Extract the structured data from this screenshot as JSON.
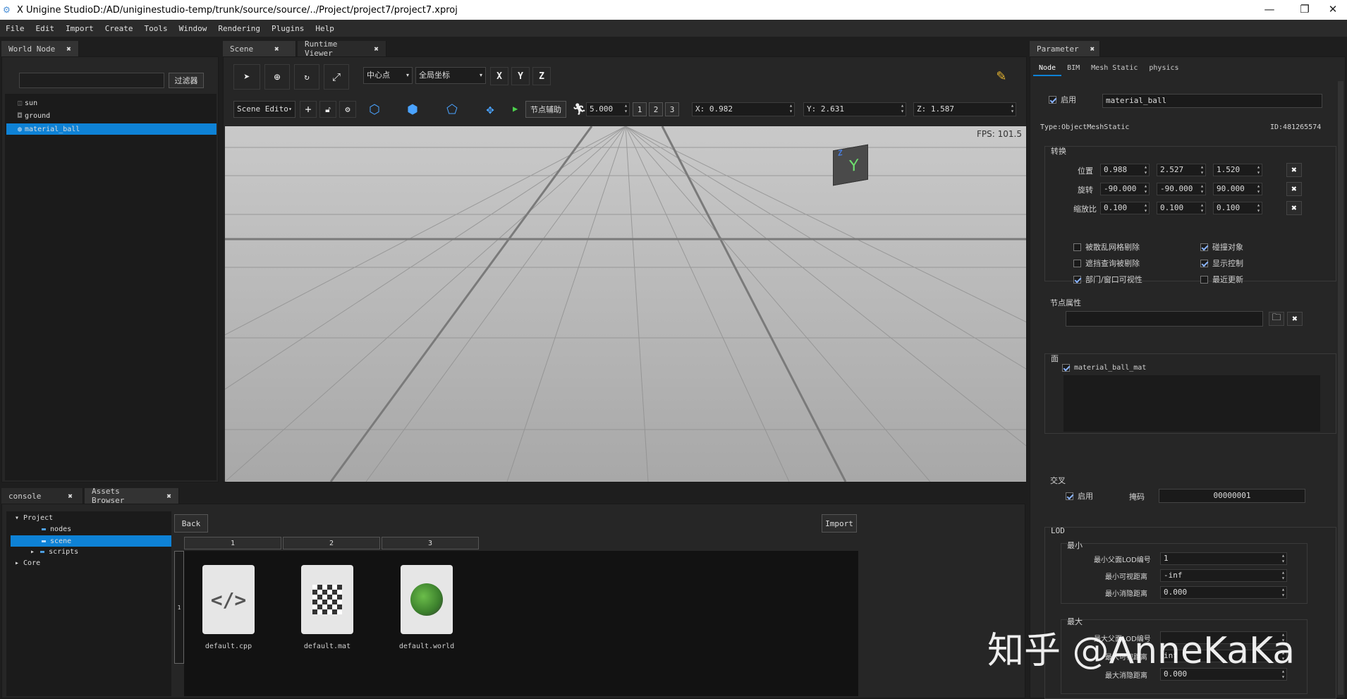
{
  "window": {
    "icon": "app-icon",
    "title": "X Unigine StudioD:/AD/uniginestudio-temp/trunk/source/source/../Project/project7/project7.xproj",
    "minimize": "—",
    "restore": "❐",
    "close": "✕"
  },
  "menu": [
    "File",
    "Edit",
    "Import",
    "Create",
    "Tools",
    "Window",
    "Rendering",
    "Plugins",
    "Help"
  ],
  "world_node": {
    "tab": "World Node",
    "filter_button": "过滤器",
    "search_value": "",
    "nodes": [
      "sun",
      "ground",
      "material_ball"
    ],
    "selected": "material_ball"
  },
  "viewport": {
    "tabs": [
      "Scene",
      "Runtime Viewer"
    ],
    "pivot": "中心点",
    "coord": "全局坐标",
    "axes": [
      "X",
      "Y",
      "Z"
    ],
    "mode": "Scene Edito",
    "node_helper": "节点辅助",
    "speed": "5.000",
    "cams": [
      "1",
      "2",
      "3"
    ],
    "x_label": "X:",
    "x_val": "0.982",
    "y_label": "Y:",
    "y_val": "2.631",
    "z_label": "Z:",
    "z_val": "1.587",
    "fps": "FPS: 101.5",
    "gizmo_top": "Z",
    "gizmo_front": "Y"
  },
  "console": {
    "tabs": [
      "console",
      "Assets Browser"
    ]
  },
  "assets": {
    "tree": [
      {
        "label": "Project",
        "level": 0,
        "arrow": "▾"
      },
      {
        "label": "nodes",
        "level": 1,
        "arrow": ""
      },
      {
        "label": "scene",
        "level": 1,
        "arrow": "",
        "selected": true
      },
      {
        "label": "scripts",
        "level": 1,
        "arrow": "▸"
      },
      {
        "label": "Core",
        "level": 0,
        "arrow": "▸"
      }
    ],
    "back": "Back",
    "import": "Import",
    "columns": [
      "1",
      "2",
      "3"
    ],
    "files": [
      {
        "name": "default.cpp",
        "icon": "code-file-icon"
      },
      {
        "name": "default.mat",
        "icon": "material-file-icon"
      },
      {
        "name": "default.world",
        "icon": "world-file-icon"
      }
    ],
    "scroll_marker": "1"
  },
  "parameter": {
    "tab": "Parameter",
    "subtabs": [
      "Node",
      "BIM",
      "Mesh Static",
      "physics"
    ],
    "enabled_label": "启用",
    "name": "material_ball",
    "type": "Type:ObjectMeshStatic",
    "id": "ID:481265574",
    "transform_title": "转换",
    "transform": [
      {
        "label": "位置",
        "v": [
          "0.988",
          "2.527",
          "1.520"
        ]
      },
      {
        "label": "旋转",
        "v": [
          "-90.000",
          "-90.000",
          "90.000"
        ]
      },
      {
        "label": "缩放比",
        "v": [
          "0.100",
          "0.100",
          "0.100"
        ]
      }
    ],
    "flags_left": [
      {
        "label": "被散乱网格剔除",
        "on": false
      },
      {
        "label": "遮挡查询被剔除",
        "on": false
      },
      {
        "label": "部门/窗口可视性",
        "on": true
      }
    ],
    "flags_right": [
      {
        "label": "碰撞对象",
        "on": true
      },
      {
        "label": "显示控制",
        "on": true
      },
      {
        "label": "最近更新",
        "on": false
      }
    ],
    "node_prop_title": "节点属性",
    "surface_title": "面",
    "surface_item": "material_ball_mat",
    "intersect_title": "交叉",
    "intersect_enabled": "启用",
    "mask_label": "掩码",
    "mask_value": "00000001",
    "lod_title": "LOD",
    "min_title": "最小",
    "min_rows": [
      {
        "label": "最小父面LOD编号",
        "value": "1"
      },
      {
        "label": "最小可视距离",
        "value": "-inf"
      },
      {
        "label": "最小消隐距离",
        "value": "0.000"
      }
    ],
    "max_title": "最大",
    "max_rows": [
      {
        "label": "最大父面LOD编号",
        "value": ""
      },
      {
        "label": "最大可视距离",
        "value": "inf"
      },
      {
        "label": "最大消隐距离",
        "value": "0.000"
      }
    ]
  },
  "watermark": "知乎 @AnneKaKa"
}
